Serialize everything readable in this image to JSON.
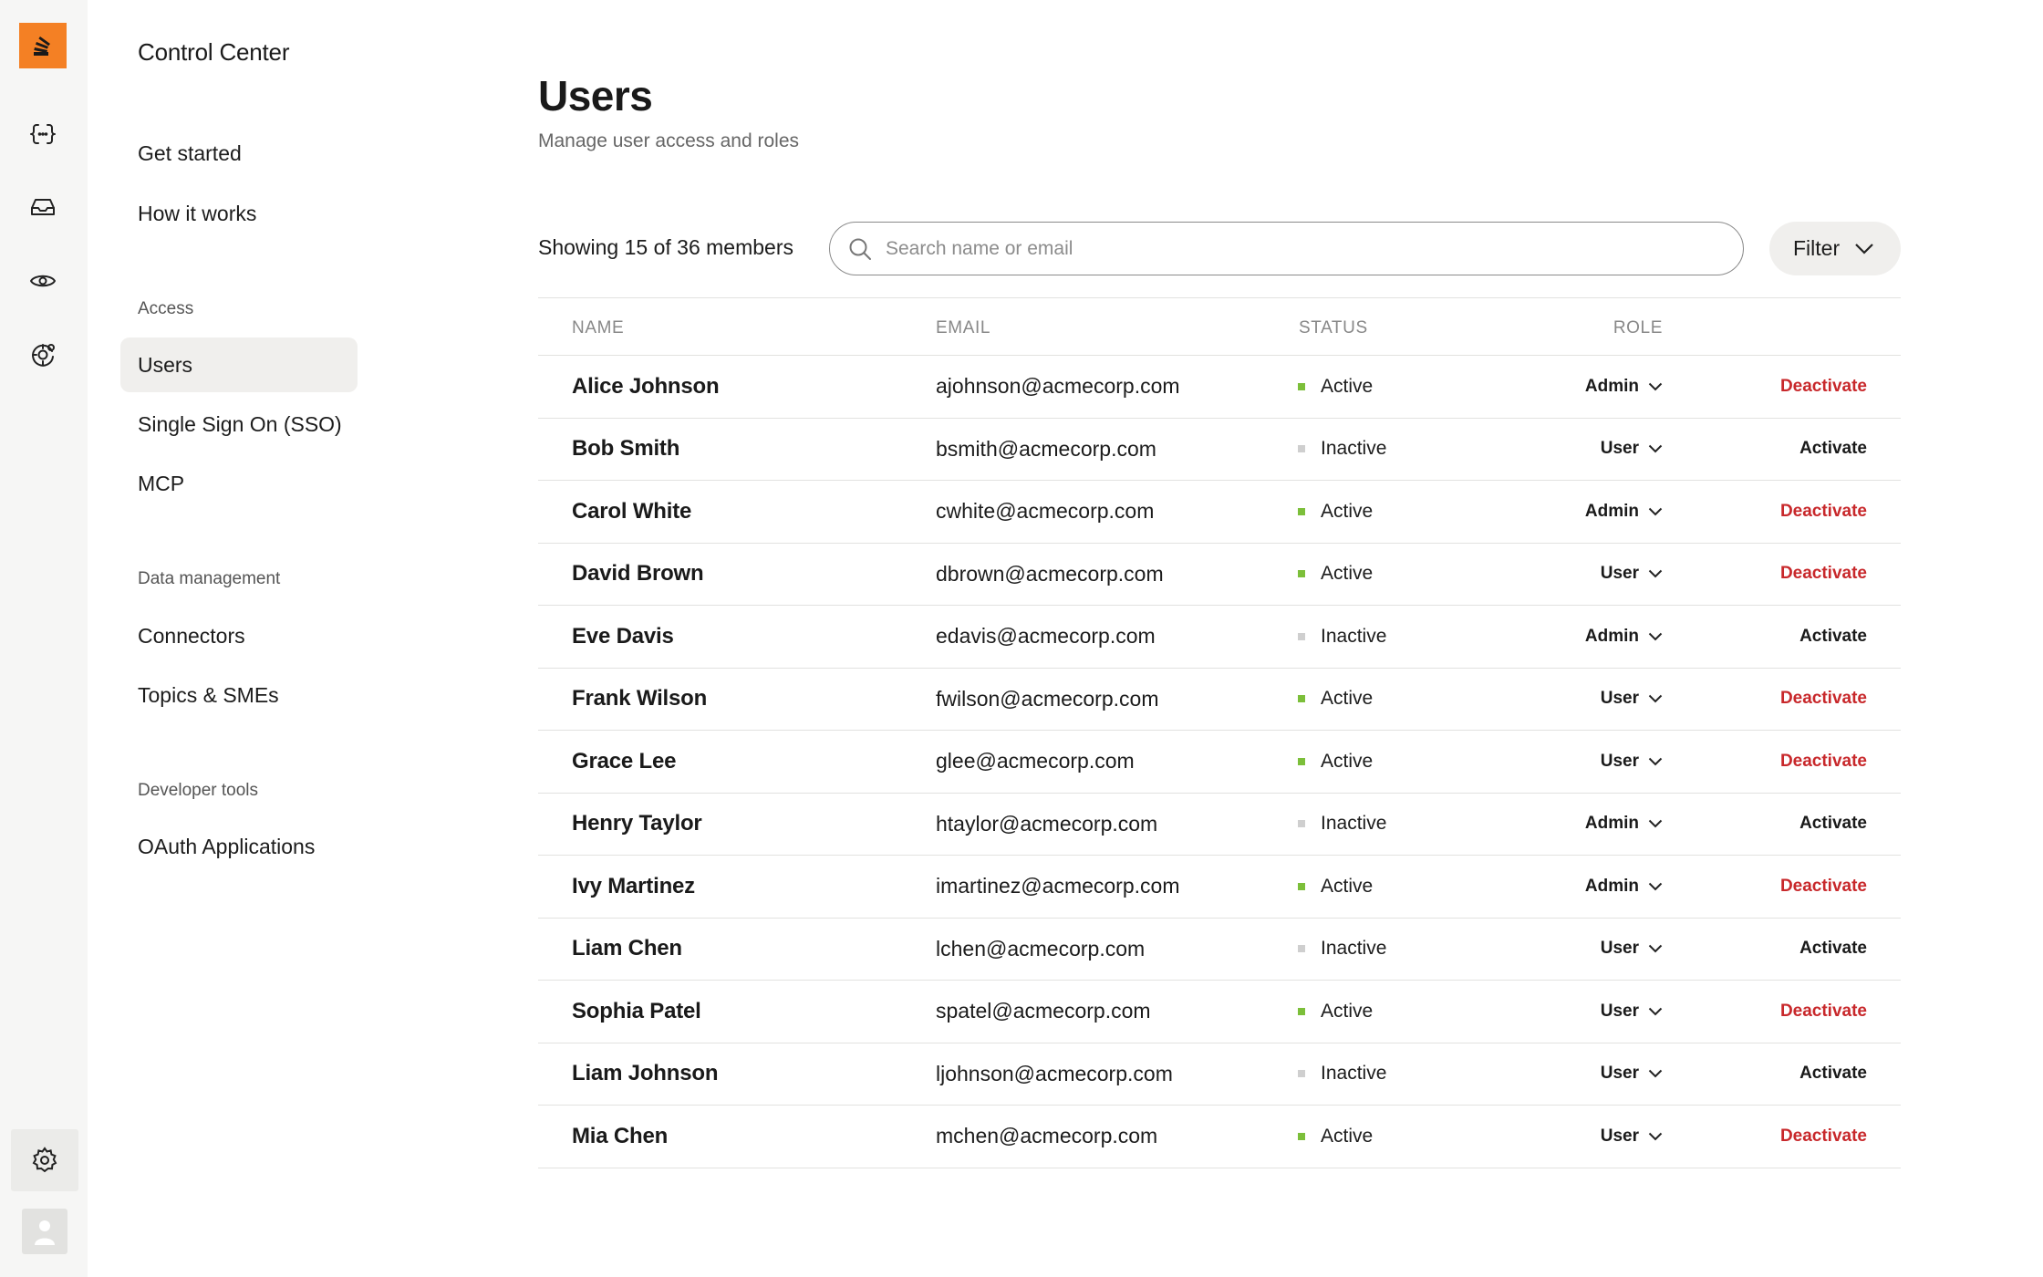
{
  "app": {
    "title": "Control Center"
  },
  "rail": {
    "icons": [
      "code-braces-icon",
      "inbox-icon",
      "eye-icon",
      "globe-settings-icon"
    ],
    "bottom": [
      "settings-icon",
      "user-avatar"
    ]
  },
  "nav": {
    "top_items": [
      {
        "label": "Get started"
      },
      {
        "label": "How it works"
      }
    ],
    "sections": [
      {
        "title": "Access",
        "items": [
          {
            "label": "Users",
            "active": true
          },
          {
            "label": "Single Sign On (SSO)"
          },
          {
            "label": "MCP"
          }
        ]
      },
      {
        "title": "Data management",
        "items": [
          {
            "label": "Connectors"
          },
          {
            "label": "Topics & SMEs"
          }
        ]
      },
      {
        "title": "Developer tools",
        "items": [
          {
            "label": "OAuth Applications"
          }
        ]
      }
    ]
  },
  "page": {
    "title": "Users",
    "subtitle": "Manage user access and roles",
    "showing": "Showing 15 of 36 members",
    "search_placeholder": "Search name or email",
    "filter_label": "Filter"
  },
  "table": {
    "headers": {
      "name": "NAME",
      "email": "EMAIL",
      "status": "STATUS",
      "role": "ROLE"
    },
    "rows": [
      {
        "name": "Alice Johnson",
        "email": "ajohnson@acmecorp.com",
        "status": "Active",
        "role": "Admin",
        "action": "Deactivate"
      },
      {
        "name": "Bob Smith",
        "email": "bsmith@acmecorp.com",
        "status": "Inactive",
        "role": "User",
        "action": "Activate"
      },
      {
        "name": "Carol White",
        "email": "cwhite@acmecorp.com",
        "status": "Active",
        "role": "Admin",
        "action": "Deactivate"
      },
      {
        "name": "David Brown",
        "email": "dbrown@acmecorp.com",
        "status": "Active",
        "role": "User",
        "action": "Deactivate"
      },
      {
        "name": "Eve Davis",
        "email": "edavis@acmecorp.com",
        "status": "Inactive",
        "role": "Admin",
        "action": "Activate"
      },
      {
        "name": "Frank Wilson",
        "email": "fwilson@acmecorp.com",
        "status": "Active",
        "role": "User",
        "action": "Deactivate"
      },
      {
        "name": "Grace Lee",
        "email": "glee@acmecorp.com",
        "status": "Active",
        "role": "User",
        "action": "Deactivate"
      },
      {
        "name": "Henry Taylor",
        "email": "htaylor@acmecorp.com",
        "status": "Inactive",
        "role": "Admin",
        "action": "Activate"
      },
      {
        "name": "Ivy Martinez",
        "email": "imartinez@acmecorp.com",
        "status": "Active",
        "role": "Admin",
        "action": "Deactivate"
      },
      {
        "name": "Liam Chen",
        "email": "lchen@acmecorp.com",
        "status": "Inactive",
        "role": "User",
        "action": "Activate"
      },
      {
        "name": "Sophia Patel",
        "email": "spatel@acmecorp.com",
        "status": "Active",
        "role": "User",
        "action": "Deactivate"
      },
      {
        "name": "Liam Johnson",
        "email": "ljohnson@acmecorp.com",
        "status": "Inactive",
        "role": "User",
        "action": "Activate"
      },
      {
        "name": "Mia Chen",
        "email": "mchen@acmecorp.com",
        "status": "Active",
        "role": "User",
        "action": "Deactivate"
      }
    ]
  },
  "colors": {
    "brand": "#f48024",
    "active_dot": "#7cbf3a",
    "inactive_dot": "#cfcfcf",
    "deactivate": "#c8282b",
    "selected_bg": "#f0efed"
  }
}
